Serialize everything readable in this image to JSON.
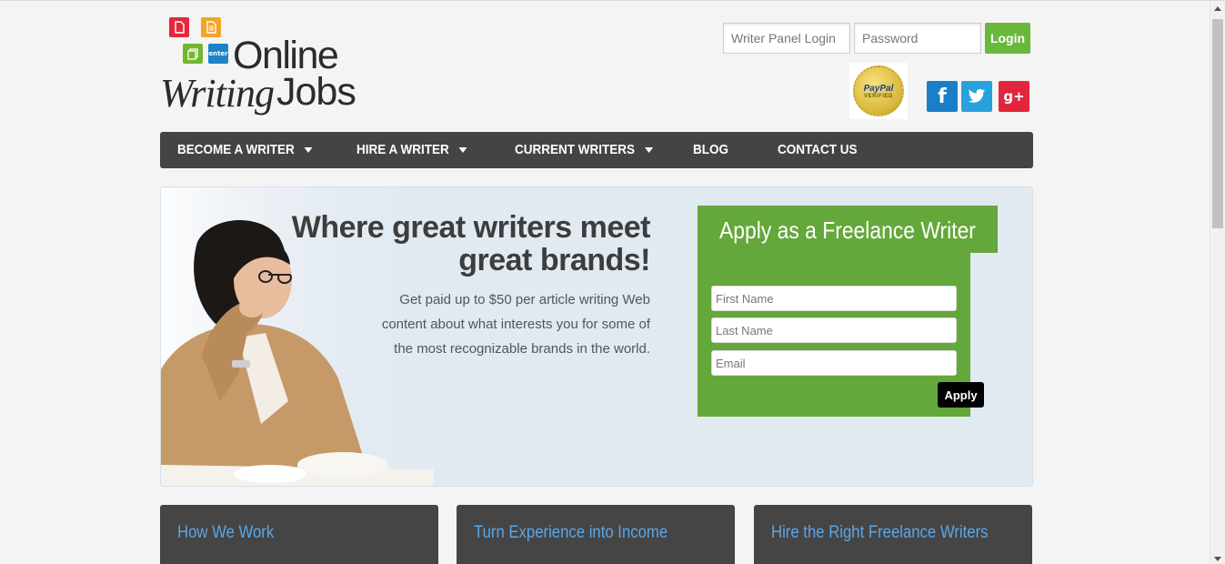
{
  "logo": {
    "line1": "Online",
    "line2": "Writing",
    "line3": "Jobs",
    "badge": "enter"
  },
  "login": {
    "username_placeholder": "Writer Panel Login",
    "password_placeholder": "Password",
    "button": "Login"
  },
  "paypal": {
    "brand": "PayPal",
    "label": "VERIFIED"
  },
  "social": {
    "facebook": "f",
    "twitter": "t",
    "google": "g+"
  },
  "nav": {
    "items": [
      {
        "label": "BECOME A WRITER"
      },
      {
        "label": "HIRE A WRITER"
      },
      {
        "label": "CURRENT WRITERS"
      },
      {
        "label": "BLOG"
      },
      {
        "label": "CONTACT US"
      }
    ]
  },
  "hero": {
    "headline_line1": "Where great writers meet",
    "headline_line2": "great brands!",
    "subtext": "Get paid up to $50 per article writing Web content about what interests you for some of the most recognizable brands in the world."
  },
  "apply": {
    "title": "Apply as a Freelance Writer",
    "first_name_placeholder": "First Name",
    "last_name_placeholder": "Last Name",
    "email_placeholder": "Email",
    "button": "Apply"
  },
  "cards": [
    {
      "title": "How We Work"
    },
    {
      "title": "Turn Experience into Income"
    },
    {
      "title": "Hire the Right Freelance Writers"
    }
  ],
  "colors": {
    "nav_bg": "#444444",
    "accent_green": "#64a73a",
    "login_green": "#6ab83b",
    "hero_bg": "#e1e9f1",
    "card_bg": "#454545",
    "card_title": "#5aa7e8"
  }
}
